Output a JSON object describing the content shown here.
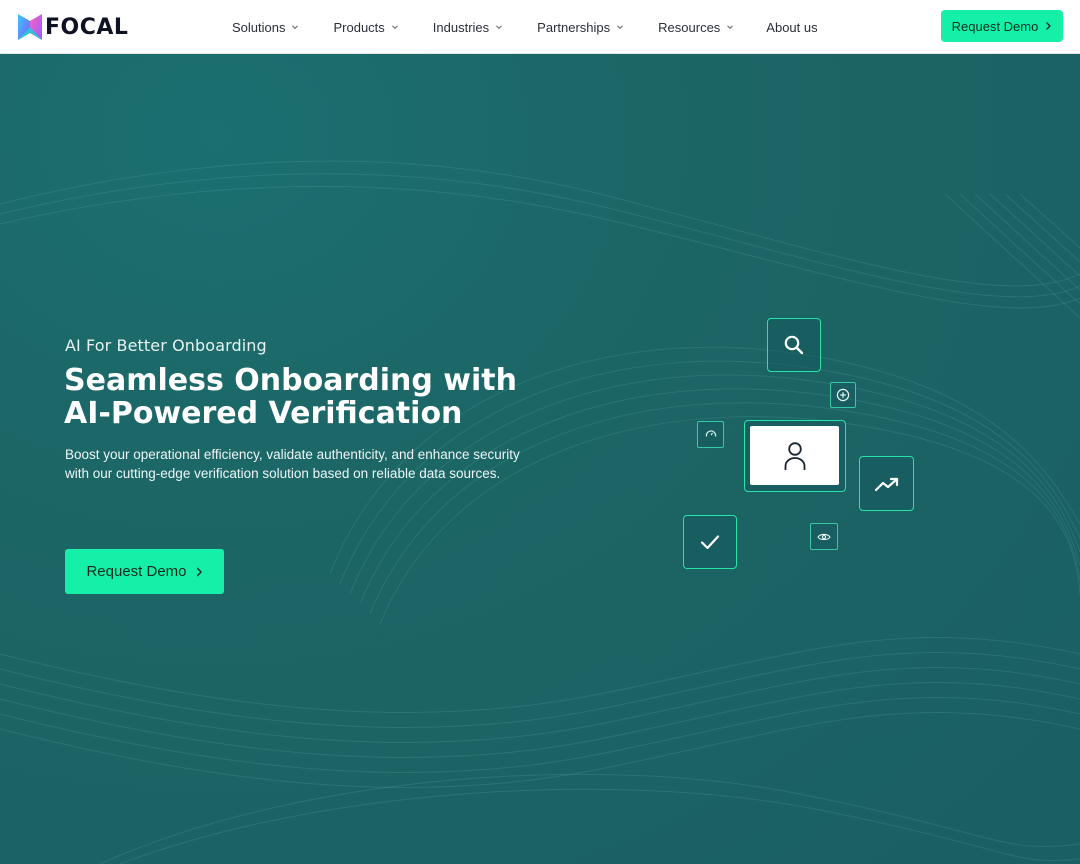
{
  "header": {
    "logo_text": "FOCAL",
    "nav": [
      {
        "label": "Solutions",
        "has_dropdown": true
      },
      {
        "label": "Products",
        "has_dropdown": true
      },
      {
        "label": "Industries",
        "has_dropdown": true
      },
      {
        "label": "Partnerships",
        "has_dropdown": true
      },
      {
        "label": "Resources",
        "has_dropdown": true
      },
      {
        "label": "About us",
        "has_dropdown": false
      }
    ],
    "cta_label": "Request Demo"
  },
  "hero": {
    "eyebrow": "AI For Better Onboarding",
    "headline": "Seamless Onboarding with AI-Powered Verification",
    "subcopy": "Boost your operational efficiency, validate authenticity, and enhance security with our cutting-edge verification solution based on reliable data sources.",
    "cta_label": "Request Demo"
  },
  "illustration": {
    "icons": [
      "search-icon",
      "plus-circle-icon",
      "loading-icon",
      "user-icon",
      "trending-up-icon",
      "check-icon",
      "eye-icon"
    ]
  },
  "colors": {
    "accent": "#15f0a8",
    "hero_bg": "#1e6a6a",
    "tile_border": "#28e2a8",
    "header_bg": "#ffffff"
  }
}
